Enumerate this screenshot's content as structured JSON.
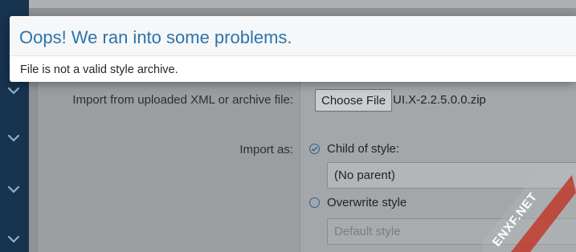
{
  "error": {
    "title": "Oops! We ran into some problems.",
    "message": "File is not a valid style archive."
  },
  "form": {
    "import_file_label": "Import from uploaded XML or archive file:",
    "choose_file_button": "Choose File",
    "file_name": "UI.X-2.2.5.0.0.zip",
    "import_as_label": "Import as:",
    "child_option_label": "Child of style:",
    "parent_select_value": "(No parent)",
    "overwrite_option_label": "Overwrite style",
    "default_style_placeholder": "Default style",
    "child_selected": true
  },
  "watermark": {
    "text": "ENXF.NET"
  },
  "colors": {
    "sidebar": "#17334f",
    "error_title": "#2e74a8",
    "watermark": "#c0392b"
  },
  "icons": [
    "chevron-down-icon",
    "radio-check-icon"
  ]
}
